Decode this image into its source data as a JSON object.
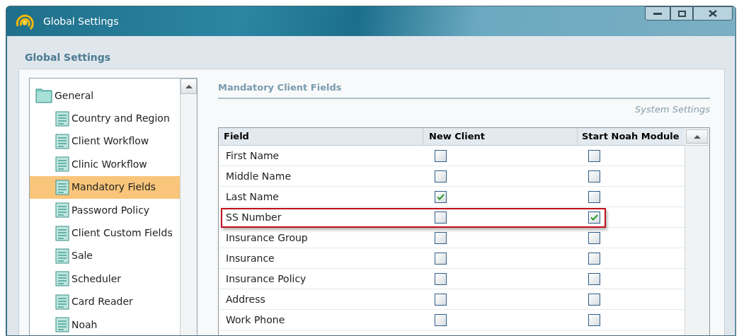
{
  "window": {
    "title": "Global Settings"
  },
  "heading": "Global Settings",
  "tree": [
    {
      "label": "General",
      "selected": false,
      "children": [
        {
          "label": "Country and Region",
          "selected": false
        },
        {
          "label": "Client Workflow",
          "selected": false
        },
        {
          "label": "Clinic Workflow",
          "selected": false
        },
        {
          "label": "Mandatory Fields",
          "selected": true
        },
        {
          "label": "Password Policy",
          "selected": false
        },
        {
          "label": "Client Custom Fields",
          "selected": false
        },
        {
          "label": "Sale",
          "selected": false
        },
        {
          "label": "Scheduler",
          "selected": false
        },
        {
          "label": "Card Reader",
          "selected": false
        },
        {
          "label": "Noah",
          "selected": false
        }
      ]
    }
  ],
  "section": {
    "title": "Mandatory Client Fields",
    "link": "System Settings"
  },
  "table": {
    "columns": [
      "Field",
      "New Client",
      "Start Noah Module"
    ],
    "rows": [
      {
        "field": "First Name",
        "new_client": false,
        "start_noah": false,
        "highlighted": false
      },
      {
        "field": "Middle Name",
        "new_client": false,
        "start_noah": false,
        "highlighted": false
      },
      {
        "field": "Last Name",
        "new_client": true,
        "start_noah": false,
        "highlighted": false
      },
      {
        "field": "SS Number",
        "new_client": false,
        "start_noah": true,
        "highlighted": true
      },
      {
        "field": "Insurance Group",
        "new_client": false,
        "start_noah": false,
        "highlighted": false
      },
      {
        "field": "Insurance",
        "new_client": false,
        "start_noah": false,
        "highlighted": false
      },
      {
        "field": "Insurance Policy",
        "new_client": false,
        "start_noah": false,
        "highlighted": false
      },
      {
        "field": "Address",
        "new_client": false,
        "start_noah": false,
        "highlighted": false
      },
      {
        "field": "Work Phone",
        "new_client": false,
        "start_noah": false,
        "highlighted": false
      }
    ]
  }
}
